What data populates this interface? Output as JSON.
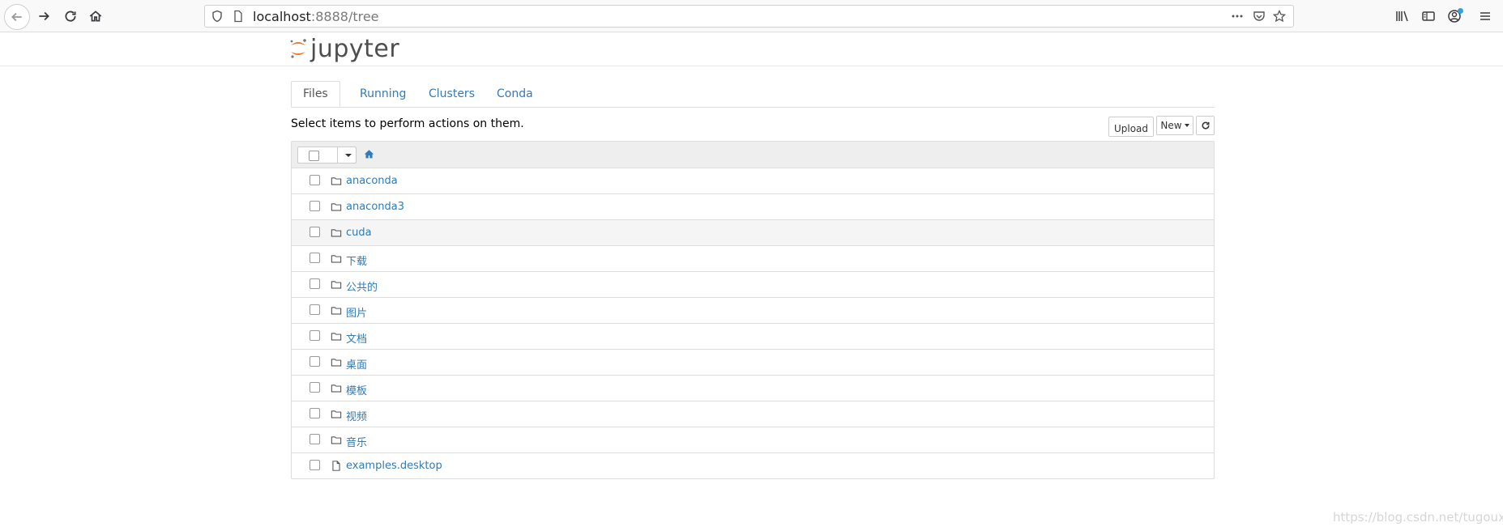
{
  "browser": {
    "url_host": "localhost",
    "url_path": ":8888/tree"
  },
  "app": {
    "logo_text": "jupyter"
  },
  "tabs": [
    {
      "label": "Files",
      "active": true
    },
    {
      "label": "Running",
      "active": false
    },
    {
      "label": "Clusters",
      "active": false
    },
    {
      "label": "Conda",
      "active": false
    }
  ],
  "toolbar": {
    "hint": "Select items to perform actions on them.",
    "upload_label": "Upload",
    "new_label": "New"
  },
  "files": [
    {
      "name": "anaconda",
      "type": "folder"
    },
    {
      "name": "anaconda3",
      "type": "folder"
    },
    {
      "name": "cuda",
      "type": "folder"
    },
    {
      "name": "下载",
      "type": "folder"
    },
    {
      "name": "公共的",
      "type": "folder"
    },
    {
      "name": "图片",
      "type": "folder"
    },
    {
      "name": "文档",
      "type": "folder"
    },
    {
      "name": "桌面",
      "type": "folder"
    },
    {
      "name": "模板",
      "type": "folder"
    },
    {
      "name": "视频",
      "type": "folder"
    },
    {
      "name": "音乐",
      "type": "folder"
    },
    {
      "name": "examples.desktop",
      "type": "file"
    }
  ],
  "watermark": "https://blog.csdn.net/tugouxp",
  "colors": {
    "link": "#337ab7",
    "logo_orange": "#f37726"
  }
}
